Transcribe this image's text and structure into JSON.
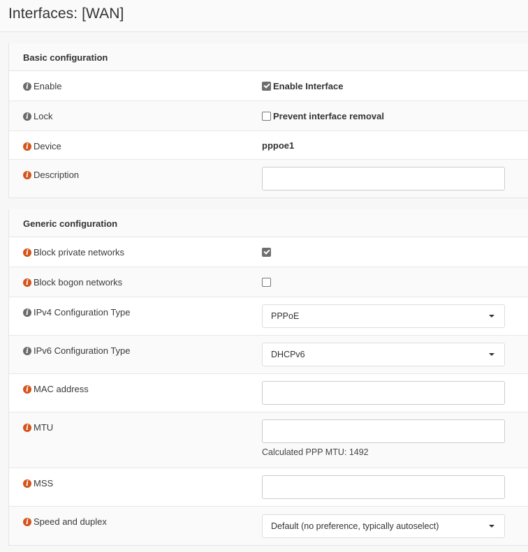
{
  "page": {
    "title": "Interfaces: [WAN]"
  },
  "colors": {
    "info_grey": "#6b6b6b",
    "info_orange": "#d4541b"
  },
  "basic": {
    "header": "Basic configuration",
    "enable": {
      "label": "Enable",
      "checkbox_label": "Enable Interface",
      "checked": true,
      "icon": "info-icon-grey"
    },
    "lock": {
      "label": "Lock",
      "checkbox_label": "Prevent interface removal",
      "checked": false,
      "icon": "info-icon-grey"
    },
    "device": {
      "label": "Device",
      "value": "pppoe1",
      "icon": "info-icon-orange"
    },
    "description": {
      "label": "Description",
      "value": "",
      "icon": "info-icon-orange"
    }
  },
  "generic": {
    "header": "Generic configuration",
    "block_private": {
      "label": "Block private networks",
      "checked": true,
      "icon": "info-icon-orange"
    },
    "block_bogon": {
      "label": "Block bogon networks",
      "checked": false,
      "icon": "info-icon-orange"
    },
    "ipv4_type": {
      "label": "IPv4 Configuration Type",
      "selected": "PPPoE",
      "icon": "info-icon-grey"
    },
    "ipv6_type": {
      "label": "IPv6 Configuration Type",
      "selected": "DHCPv6",
      "icon": "info-icon-grey"
    },
    "mac": {
      "label": "MAC address",
      "value": "",
      "icon": "info-icon-orange"
    },
    "mtu": {
      "label": "MTU",
      "value": "",
      "help": "Calculated PPP MTU: 1492",
      "icon": "info-icon-orange"
    },
    "mss": {
      "label": "MSS",
      "value": "",
      "icon": "info-icon-orange"
    },
    "speed": {
      "label": "Speed and duplex",
      "selected": "Default (no preference, typically autoselect)",
      "icon": "info-icon-orange"
    }
  }
}
